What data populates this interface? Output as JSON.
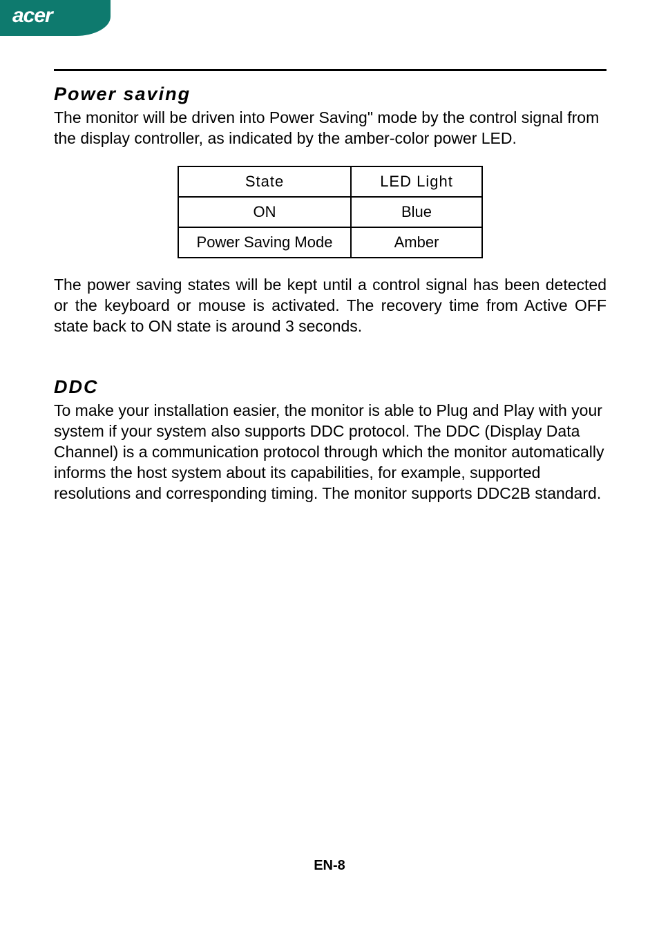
{
  "brand": "acer",
  "sections": {
    "power_saving": {
      "heading": "Power saving",
      "intro": "The monitor will be driven into Power Saving\" mode by the control signal from the display controller, as indicated by the amber-color power LED.",
      "outro": "The power saving states will be kept until a control signal has been detected or the keyboard or mouse is activated. The recovery time from Active OFF state back to ON state is around 3 seconds."
    },
    "ddc": {
      "heading": "DDC",
      "body": "To make your installation easier, the monitor is able to Plug and Play with your system if your system also supports DDC protocol. The DDC (Display Data Channel) is a communication protocol through which the monitor automatically informs the host system  about its capabilities, for example, supported resolutions and corresponding timing. The monitor supports DDC2B standard."
    }
  },
  "table": {
    "headers": {
      "state": "State",
      "led": "LED Light"
    },
    "rows": [
      {
        "state": "ON",
        "led": "Blue"
      },
      {
        "state": "Power Saving Mode",
        "led": "Amber"
      }
    ]
  },
  "page_number": "EN-8"
}
